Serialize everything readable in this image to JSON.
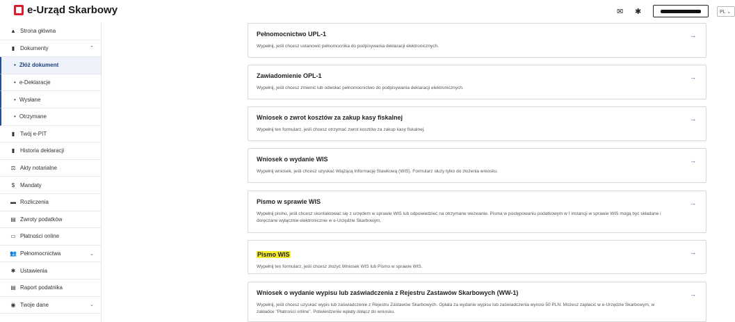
{
  "header": {
    "logo_text": "e-Urząd Skarbowy",
    "lang": "PL ⌄",
    "icons": [
      "mail-icon",
      "gear-icon"
    ]
  },
  "sidebar": {
    "items": [
      {
        "label": "Strona główna",
        "icon": "▲"
      },
      {
        "label": "Dokumenty",
        "icon": "▮",
        "chevron": "⌃"
      },
      {
        "label": "Złóż dokument",
        "sub": true,
        "active": true
      },
      {
        "label": "e-Deklaracje",
        "sub": true
      },
      {
        "label": "Wysłane",
        "sub": true
      },
      {
        "label": "Otrzymane",
        "sub": true
      },
      {
        "label": "Twój e-PIT",
        "icon": "▮"
      },
      {
        "label": "Historia deklaracji",
        "icon": "▮"
      },
      {
        "label": "Akty notarialne",
        "icon": "⚖"
      },
      {
        "label": "Mandaty",
        "icon": "$"
      },
      {
        "label": "Rozliczenia",
        "icon": "▬"
      },
      {
        "label": "Zwroty podatków",
        "icon": "▤"
      },
      {
        "label": "Płatności online",
        "icon": "▭"
      },
      {
        "label": "Pełnomocnictwa",
        "icon": "👥",
        "chevron": "⌄"
      },
      {
        "label": "Ustawienia",
        "icon": "✱"
      },
      {
        "label": "Raport podatnika",
        "icon": "▤"
      },
      {
        "label": "Twoje dane",
        "icon": "◉",
        "chevron": "⌄"
      }
    ]
  },
  "cards": [
    {
      "title": "Pełnomocnictwo UPL-1",
      "desc": "Wypełnij, jeśli chcesz ustanowić pełnomocnika do podpisywania deklaracji elektronicznych."
    },
    {
      "title": "Zawiadomienie OPL-1",
      "desc": "Wypełnij, jeśli chcesz zmienić lub odwołać pełnomocnictwo do podpisywania deklaracji elektronicznych."
    },
    {
      "title": "Wniosek o zwrot kosztów za zakup kasy fiskalnej",
      "desc": "Wypełnij ten formularz, jeśli chcesz otrzymać zwrot kosztów za zakup kasy fiskalnej."
    },
    {
      "title": "Wniosek o wydanie WIS",
      "desc": "Wypełnij wniosek, jeśli chcesz uzyskać Wiążącą Informację Stawkową (WIS). Formularz służy tylko do złożenia wniosku."
    },
    {
      "title": "Pismo w sprawie WIS",
      "desc": "Wypełnij pismo, jeśli chcesz skontaktować się z urzędem w sprawie WIS lub odpowiedzieć na otrzymane wezwanie. Pisma w postępowaniu podatkowym w I instancji w sprawie WIS mogą być składane i doręczane wyłącznie elektronicznie w e-Urzędzie Skarbowym."
    },
    {
      "title": "Pismo WIS",
      "desc": "Wypełnij ten formularz, jeśli chcesz złożyć Wniosek WIS lub Pismo w sprawie WIS.",
      "highlight": true
    },
    {
      "title": "Wniosek o wydanie wypisu lub zaświadczenia z Rejestru Zastawów Skarbowych (WW-1)",
      "desc": "Wypełnij, jeśli chcesz uzyskać wypis lub zaświadczenie z Rejestru Zastawów Skarbowych. Opłata za wydanie wypisu lub zaświadczenia wynosi 50 PLN. Możesz zapłacić w e-Urzędzie Skarbowym, w zakładce \"Płatności online\". Potwierdzenie wpłaty dołącz do wniosku."
    }
  ],
  "arrow": "→",
  "colors": {
    "brand": "#d6202f",
    "accent": "#1f4e9c",
    "highlight": "#f5ec2c"
  }
}
